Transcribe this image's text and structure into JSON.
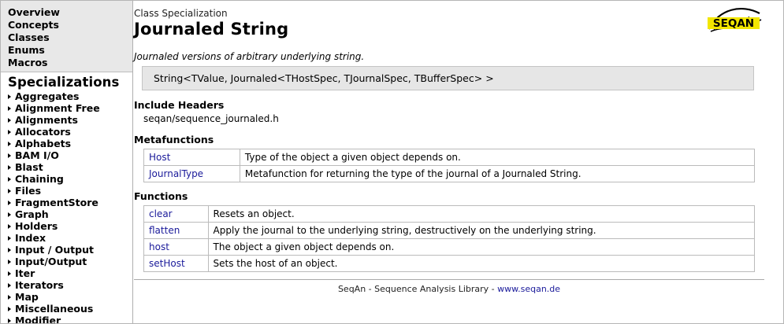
{
  "nav": {
    "top_links": [
      "Overview",
      "Concepts",
      "Classes",
      "Enums",
      "Macros"
    ],
    "section_heading": "Specializations",
    "items": [
      "Aggregates",
      "Alignment Free",
      "Alignments",
      "Allocators",
      "Alphabets",
      "BAM I/O",
      "Blast",
      "Chaining",
      "Files",
      "FragmentStore",
      "Graph",
      "Holders",
      "Index",
      "Input / Output",
      "Input/Output",
      "Iter",
      "Iterators",
      "Map",
      "Miscellaneous",
      "Modifier"
    ]
  },
  "header": {
    "kind": "Class Specialization",
    "title": "Journaled String",
    "logo_text": "SEQAN",
    "description": "Journaled versions of arbitrary underlying string.",
    "signature": "String<TValue, Journaled<THostSpec, TJournalSpec, TBufferSpec> >"
  },
  "include": {
    "heading": "Include Headers",
    "file": "seqan/sequence_journaled.h"
  },
  "metafunctions": {
    "heading": "Metafunctions",
    "rows": [
      {
        "name": "Host",
        "desc": "Type of the object a given object depends on."
      },
      {
        "name": "JournalType",
        "desc": "Metafunction for returning the type of the journal of a Journaled String."
      }
    ]
  },
  "functions": {
    "heading": "Functions",
    "rows": [
      {
        "name": "clear",
        "desc": "Resets an object."
      },
      {
        "name": "flatten",
        "desc": "Apply the journal to the underlying string, destructively on the underlying string."
      },
      {
        "name": "host",
        "desc": "The object a given object depends on."
      },
      {
        "name": "setHost",
        "desc": "Sets the host of an object."
      }
    ]
  },
  "footer": {
    "text": "SeqAn - Sequence Analysis Library - ",
    "link": "www.seqan.de"
  },
  "colors": {
    "link": "#1a1a9a",
    "logo_yellow": "#f2e600",
    "nav_bg": "#e8e8e8",
    "signature_bg": "#e6e6e6"
  }
}
